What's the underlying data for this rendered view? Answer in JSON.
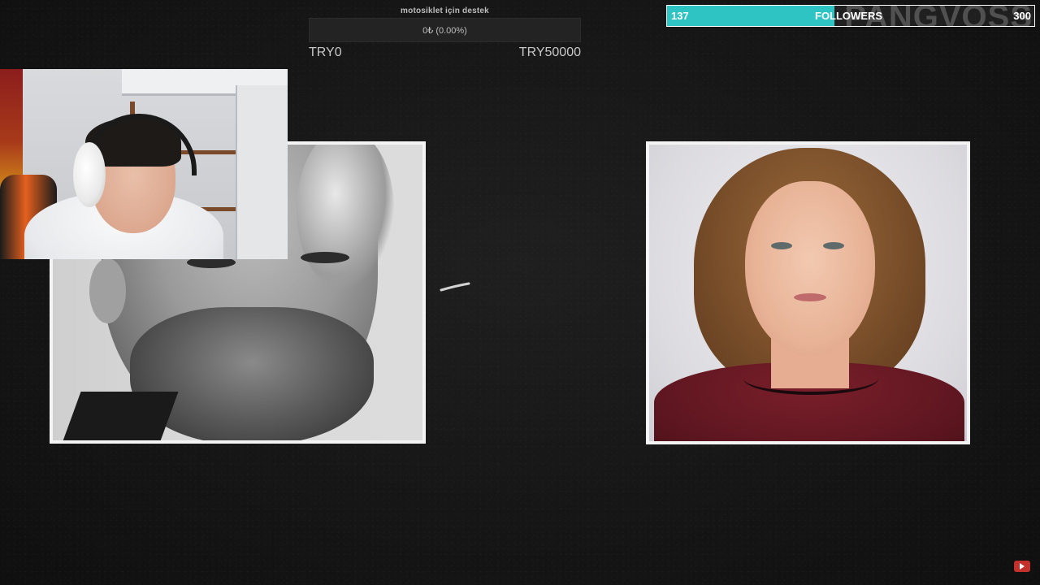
{
  "donation_goal": {
    "title": "motosiklet için destek",
    "progress_text": "0₺ (0.00%)",
    "progress_fraction": 0.0,
    "min_label": "TRY0",
    "max_label": "TRY50000",
    "bar_color": "#3b6fd6"
  },
  "follower_goal": {
    "current": "137",
    "label": "FOLLOWERS",
    "target": "300",
    "brand": "PANGVOSS",
    "progress_fraction": 0.4567,
    "bar_color": "#2ec4c4"
  },
  "photos": {
    "left": {
      "subject": "greyscale-portrait-man"
    },
    "right": {
      "subject": "color-portrait-woman"
    }
  },
  "webcam": {
    "subject": "streamer-webcam"
  },
  "icons": {
    "corner": "video-platform-icon"
  },
  "colors": {
    "background": "#161616",
    "frame": "#f4f4f4"
  }
}
